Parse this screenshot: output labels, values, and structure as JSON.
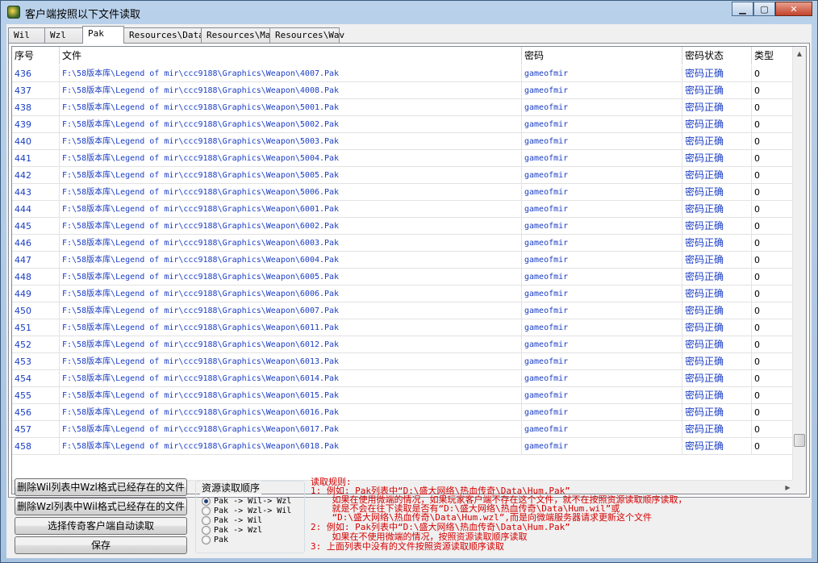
{
  "window": {
    "title": "客户端按照以下文件读取"
  },
  "tabs": [
    {
      "label": "Wil"
    },
    {
      "label": "Wzl"
    },
    {
      "label": "Pak"
    },
    {
      "label": "Resources\\Data"
    },
    {
      "label": "Resources\\Map"
    },
    {
      "label": "Resources\\Wav"
    }
  ],
  "columns": {
    "index": "序号",
    "file": "文件",
    "password": "密码",
    "status": "密码状态",
    "type": "类型"
  },
  "rows": [
    {
      "index": "436",
      "file": "F:\\58版本库\\Legend of mir\\ccc9188\\Graphics\\Weapon\\4007.Pak",
      "password": "gameofmir",
      "status": "密码正确",
      "type": "0"
    },
    {
      "index": "437",
      "file": "F:\\58版本库\\Legend of mir\\ccc9188\\Graphics\\Weapon\\4008.Pak",
      "password": "gameofmir",
      "status": "密码正确",
      "type": "0"
    },
    {
      "index": "438",
      "file": "F:\\58版本库\\Legend of mir\\ccc9188\\Graphics\\Weapon\\5001.Pak",
      "password": "gameofmir",
      "status": "密码正确",
      "type": "0"
    },
    {
      "index": "439",
      "file": "F:\\58版本库\\Legend of mir\\ccc9188\\Graphics\\Weapon\\5002.Pak",
      "password": "gameofmir",
      "status": "密码正确",
      "type": "0"
    },
    {
      "index": "440",
      "file": "F:\\58版本库\\Legend of mir\\ccc9188\\Graphics\\Weapon\\5003.Pak",
      "password": "gameofmir",
      "status": "密码正确",
      "type": "0"
    },
    {
      "index": "441",
      "file": "F:\\58版本库\\Legend of mir\\ccc9188\\Graphics\\Weapon\\5004.Pak",
      "password": "gameofmir",
      "status": "密码正确",
      "type": "0"
    },
    {
      "index": "442",
      "file": "F:\\58版本库\\Legend of mir\\ccc9188\\Graphics\\Weapon\\5005.Pak",
      "password": "gameofmir",
      "status": "密码正确",
      "type": "0"
    },
    {
      "index": "443",
      "file": "F:\\58版本库\\Legend of mir\\ccc9188\\Graphics\\Weapon\\5006.Pak",
      "password": "gameofmir",
      "status": "密码正确",
      "type": "0"
    },
    {
      "index": "444",
      "file": "F:\\58版本库\\Legend of mir\\ccc9188\\Graphics\\Weapon\\6001.Pak",
      "password": "gameofmir",
      "status": "密码正确",
      "type": "0"
    },
    {
      "index": "445",
      "file": "F:\\58版本库\\Legend of mir\\ccc9188\\Graphics\\Weapon\\6002.Pak",
      "password": "gameofmir",
      "status": "密码正确",
      "type": "0"
    },
    {
      "index": "446",
      "file": "F:\\58版本库\\Legend of mir\\ccc9188\\Graphics\\Weapon\\6003.Pak",
      "password": "gameofmir",
      "status": "密码正确",
      "type": "0"
    },
    {
      "index": "447",
      "file": "F:\\58版本库\\Legend of mir\\ccc9188\\Graphics\\Weapon\\6004.Pak",
      "password": "gameofmir",
      "status": "密码正确",
      "type": "0"
    },
    {
      "index": "448",
      "file": "F:\\58版本库\\Legend of mir\\ccc9188\\Graphics\\Weapon\\6005.Pak",
      "password": "gameofmir",
      "status": "密码正确",
      "type": "0"
    },
    {
      "index": "449",
      "file": "F:\\58版本库\\Legend of mir\\ccc9188\\Graphics\\Weapon\\6006.Pak",
      "password": "gameofmir",
      "status": "密码正确",
      "type": "0"
    },
    {
      "index": "450",
      "file": "F:\\58版本库\\Legend of mir\\ccc9188\\Graphics\\Weapon\\6007.Pak",
      "password": "gameofmir",
      "status": "密码正确",
      "type": "0"
    },
    {
      "index": "451",
      "file": "F:\\58版本库\\Legend of mir\\ccc9188\\Graphics\\Weapon\\6011.Pak",
      "password": "gameofmir",
      "status": "密码正确",
      "type": "0"
    },
    {
      "index": "452",
      "file": "F:\\58版本库\\Legend of mir\\ccc9188\\Graphics\\Weapon\\6012.Pak",
      "password": "gameofmir",
      "status": "密码正确",
      "type": "0"
    },
    {
      "index": "453",
      "file": "F:\\58版本库\\Legend of mir\\ccc9188\\Graphics\\Weapon\\6013.Pak",
      "password": "gameofmir",
      "status": "密码正确",
      "type": "0"
    },
    {
      "index": "454",
      "file": "F:\\58版本库\\Legend of mir\\ccc9188\\Graphics\\Weapon\\6014.Pak",
      "password": "gameofmir",
      "status": "密码正确",
      "type": "0"
    },
    {
      "index": "455",
      "file": "F:\\58版本库\\Legend of mir\\ccc9188\\Graphics\\Weapon\\6015.Pak",
      "password": "gameofmir",
      "status": "密码正确",
      "type": "0"
    },
    {
      "index": "456",
      "file": "F:\\58版本库\\Legend of mir\\ccc9188\\Graphics\\Weapon\\6016.Pak",
      "password": "gameofmir",
      "status": "密码正确",
      "type": "0"
    },
    {
      "index": "457",
      "file": "F:\\58版本库\\Legend of mir\\ccc9188\\Graphics\\Weapon\\6017.Pak",
      "password": "gameofmir",
      "status": "密码正确",
      "type": "0"
    },
    {
      "index": "458",
      "file": "F:\\58版本库\\Legend of mir\\ccc9188\\Graphics\\Weapon\\6018.Pak",
      "password": "gameofmir",
      "status": "密码正确",
      "type": "0"
    }
  ],
  "buttons": {
    "delete_wil": "删除Wil列表中Wzl格式已经存在的文件",
    "delete_wzl": "删除Wzl列表中Wil格式已经存在的文件",
    "auto_read": "选择传奇客户端自动读取",
    "save": "保存"
  },
  "order": {
    "title": "资源读取顺序",
    "options": [
      {
        "label": "Pak -> Wil-> Wzl",
        "selected": true
      },
      {
        "label": "Pak -> Wzl-> Wil",
        "selected": false
      },
      {
        "label": "Pak -> Wil",
        "selected": false
      },
      {
        "label": "Pak -> Wzl",
        "selected": false
      },
      {
        "label": "Pak",
        "selected": false
      }
    ]
  },
  "rules": [
    "读取规则:",
    "1: 例如: Pak列表中“D:\\盛大网络\\热血传奇\\Data\\Hum.Pak”",
    "    如果在使用微端的情况，如果玩家客户端不存在这个文件，就不在按照资源读取顺序读取，",
    "    就是不会在往下读取是否有“D:\\盛大网络\\热血传奇\\Data\\Hum.wil”或",
    "    “D:\\盛大网络\\热血传奇\\Data\\Hum.wzl”,而是向微端服务器请求更新这个文件",
    "2: 例如: Pak列表中“D:\\盛大网络\\热血传奇\\Data\\Hum.Pak”",
    "    如果在不使用微端的情况，按照资源读取顺序读取",
    "3: 上面列表中没有的文件按照资源读取顺序读取"
  ],
  "colors": {
    "link_text": "#1a3dc4",
    "rules_text": "#d40000"
  }
}
